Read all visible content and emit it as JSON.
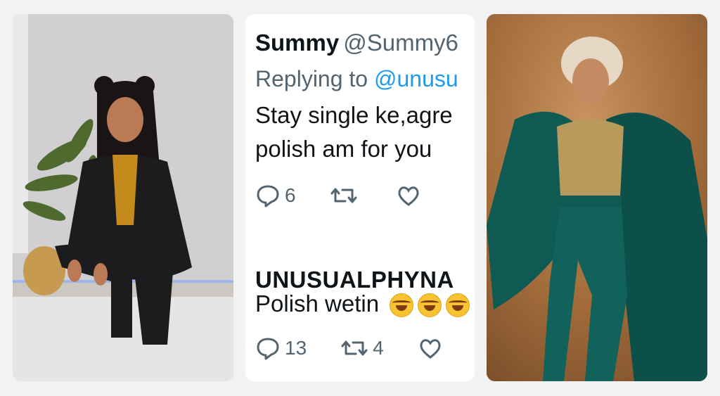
{
  "tweets": [
    {
      "name": "Summy",
      "handle": "@Summy6",
      "reply_prefix": "Replying to",
      "reply_mention": "@unusu",
      "text_line1": "Stay single ke,agre",
      "text_line2": "polish am for you",
      "replies": "6",
      "retweets": ""
    },
    {
      "name": "UNUSUALPHYNA",
      "text": "Polish wetin",
      "emoji_count": 3,
      "replies": "13",
      "retweets": "4"
    }
  ],
  "icons": [
    "reply-icon",
    "retweet-icon",
    "like-icon"
  ],
  "colors": {
    "link": "#1d9bf0",
    "muted": "#536471",
    "text": "#0f1419",
    "left_suit": "#1c1b1d",
    "left_shirt": "#c48a1c",
    "right_gown": "#0f5b54",
    "right_background": "#a9713f"
  }
}
